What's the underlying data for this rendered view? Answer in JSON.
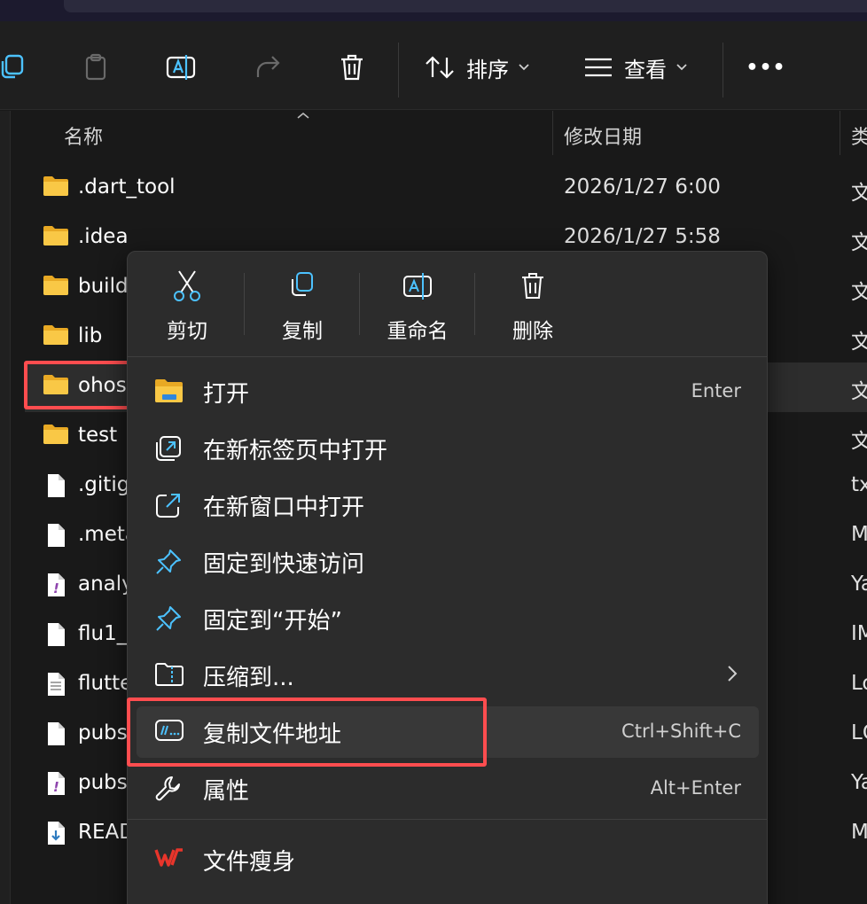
{
  "toolbar": {
    "sort_label": "排序",
    "view_label": "查看",
    "more_label": "•••"
  },
  "columns": {
    "name": "名称",
    "modified": "修改日期",
    "type": "类"
  },
  "files": [
    {
      "name": ".dart_tool",
      "date": "2026/1/27 6:00",
      "type": "文",
      "icon": "folder-icon"
    },
    {
      "name": ".idea",
      "date": "2026/1/27 5:58",
      "type": "文",
      "icon": "folder-icon"
    },
    {
      "name": "build",
      "date": "",
      "type": "文",
      "icon": "folder-icon"
    },
    {
      "name": "lib",
      "date": "",
      "type": "文",
      "icon": "folder-icon"
    },
    {
      "name": "ohos",
      "date": "",
      "type": "文",
      "icon": "folder-icon"
    },
    {
      "name": "test",
      "date": "",
      "type": "文",
      "icon": "folder-icon"
    },
    {
      "name": ".gitig",
      "date": "",
      "type": "tx",
      "icon": "file-icon"
    },
    {
      "name": ".meta",
      "date": "",
      "type": "M",
      "icon": "file-icon"
    },
    {
      "name": "analy",
      "date": "",
      "type": "Ya",
      "icon": "yaml-file-icon"
    },
    {
      "name": "flu1_",
      "date": "",
      "type": "IM",
      "icon": "file-icon"
    },
    {
      "name": "flutte",
      "date": "",
      "type": "Lo",
      "icon": "text-file-icon"
    },
    {
      "name": "pubs",
      "date": "",
      "type": "LC",
      "icon": "file-icon"
    },
    {
      "name": "pubs",
      "date": "",
      "type": "Ya",
      "icon": "yaml-file-icon"
    },
    {
      "name": "READ",
      "date": "",
      "type": "M",
      "icon": "markdown-file-icon"
    }
  ],
  "context_menu": {
    "quick_actions": [
      {
        "label": "剪切",
        "icon": "scissors-icon"
      },
      {
        "label": "复制",
        "icon": "copy-icon"
      },
      {
        "label": "重命名",
        "icon": "rename-icon"
      },
      {
        "label": "删除",
        "icon": "trash-icon"
      }
    ],
    "items": [
      {
        "label": "打开",
        "shortcut": "Enter",
        "icon": "folder-open-icon"
      },
      {
        "label": "在新标签页中打开",
        "shortcut": "",
        "icon": "new-tab-icon"
      },
      {
        "label": "在新窗口中打开",
        "shortcut": "",
        "icon": "new-window-icon"
      },
      {
        "label": "固定到快速访问",
        "shortcut": "",
        "icon": "pin-icon"
      },
      {
        "label": "固定到“开始”",
        "shortcut": "",
        "icon": "pin-icon"
      },
      {
        "label": "压缩到...",
        "shortcut": "",
        "icon": "zip-icon"
      },
      {
        "label": "复制文件地址",
        "shortcut": "Ctrl+Shift+C",
        "icon": "copy-path-icon"
      },
      {
        "label": "属性",
        "shortcut": "Alt+Enter",
        "icon": "wrench-icon"
      },
      {
        "label": "文件瘦身",
        "shortcut": "",
        "icon": "wps-icon"
      }
    ]
  },
  "colors": {
    "highlight": "#ff4d4f",
    "folder": "#f9c846",
    "accent": "#4cc2ff"
  }
}
